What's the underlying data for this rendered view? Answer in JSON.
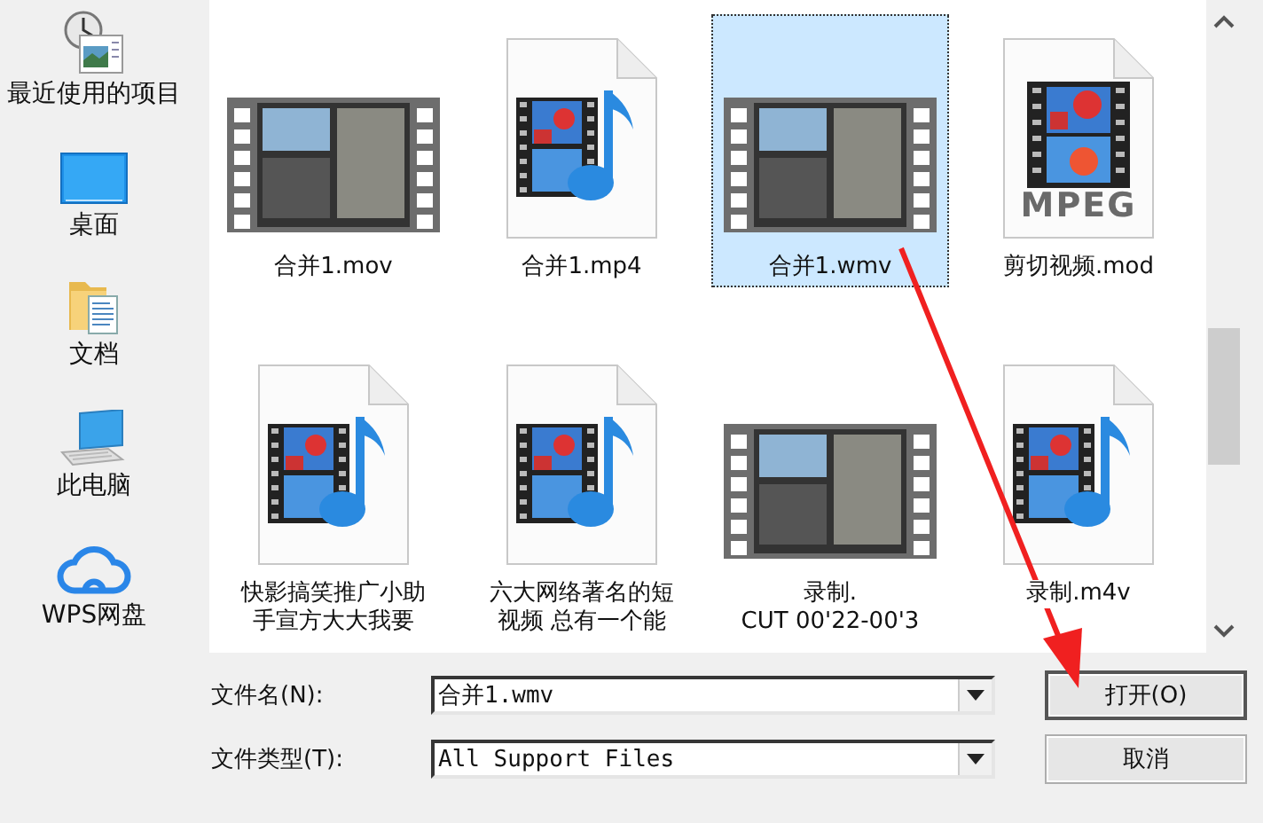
{
  "places": [
    {
      "kind": "recent",
      "label": "最近使用的项目"
    },
    {
      "kind": "desktop",
      "label": "桌面"
    },
    {
      "kind": "documents",
      "label": "文档"
    },
    {
      "kind": "computer",
      "label": "此电脑"
    },
    {
      "kind": "cloud",
      "label": "WPS网盘"
    }
  ],
  "files": [
    {
      "kind": "video",
      "label_lines": [
        "合并1.mov"
      ],
      "selected": false
    },
    {
      "kind": "media",
      "label_lines": [
        "合并1.mp4"
      ],
      "selected": false
    },
    {
      "kind": "video",
      "label_lines": [
        "合并1.wmv"
      ],
      "selected": true
    },
    {
      "kind": "mpeg",
      "badge": "MPEG",
      "label_lines": [
        "剪切视频.mod"
      ],
      "selected": false
    },
    {
      "kind": "media",
      "label_lines": [
        "快影搞笑推广小助",
        "手宣方大大我要"
      ],
      "selected": false
    },
    {
      "kind": "media",
      "label_lines": [
        "六大网络著名的短",
        "视频 总有一个能"
      ],
      "selected": false
    },
    {
      "kind": "video",
      "label_lines": [
        "录制.",
        "CUT 00'22-00'3"
      ],
      "selected": false
    },
    {
      "kind": "media",
      "label_lines": [
        "录制.m4v"
      ],
      "selected": false
    }
  ],
  "form": {
    "filename_label": "文件名(N):",
    "filename": "合并1.wmv",
    "filetype_label": "文件类型(T):",
    "filetype": "All Support Files",
    "buttons": [
      {
        "label": "打开(O)",
        "default": true
      },
      {
        "label": "取消",
        "default": false
      }
    ]
  }
}
